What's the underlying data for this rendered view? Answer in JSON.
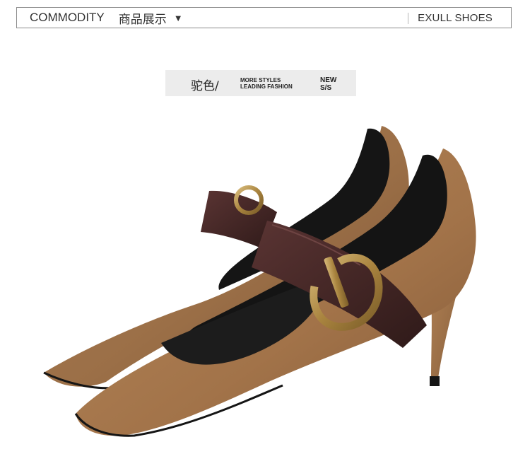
{
  "header": {
    "title_en": "COMMODITY",
    "title_cn": "商品展示",
    "caret": "▼",
    "brand": "EXULL SHOES"
  },
  "tag": {
    "color_name": "驼色/",
    "slogan_line1": "MORE STYLES",
    "slogan_line2": "LEADING FASHION",
    "season_line1": "NEW",
    "season_line2": "S/S"
  },
  "colors": {
    "suede": "#9b6f47",
    "strap": "#3f2322",
    "buckle": "#b28f4f",
    "tag_bg": "#ececec"
  },
  "product_image": {
    "icon": "mary-jane-pump-pair-image"
  }
}
